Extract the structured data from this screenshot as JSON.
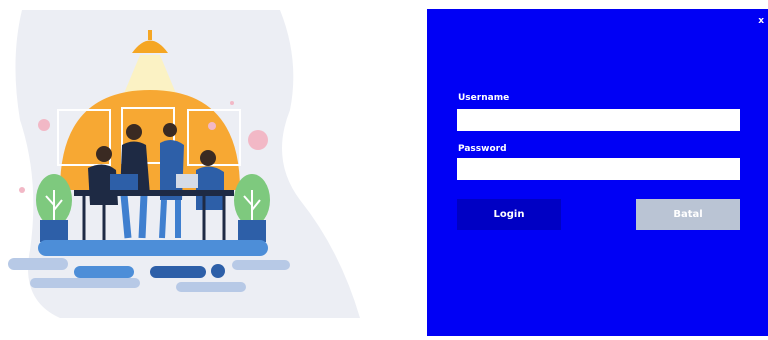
{
  "window": {
    "close_label": "x"
  },
  "form": {
    "username_label": "Username",
    "username_value": "",
    "password_label": "Password",
    "password_value": ""
  },
  "buttons": {
    "login_label": "Login",
    "cancel_label": "Batal"
  },
  "colors": {
    "panel_background": "#0000f5",
    "login_button": "#0000c4",
    "cancel_button": "#bac4d4",
    "illustration_accent": "#f5a623"
  },
  "illustration": {
    "description_icon": "team-meeting-illustration"
  }
}
